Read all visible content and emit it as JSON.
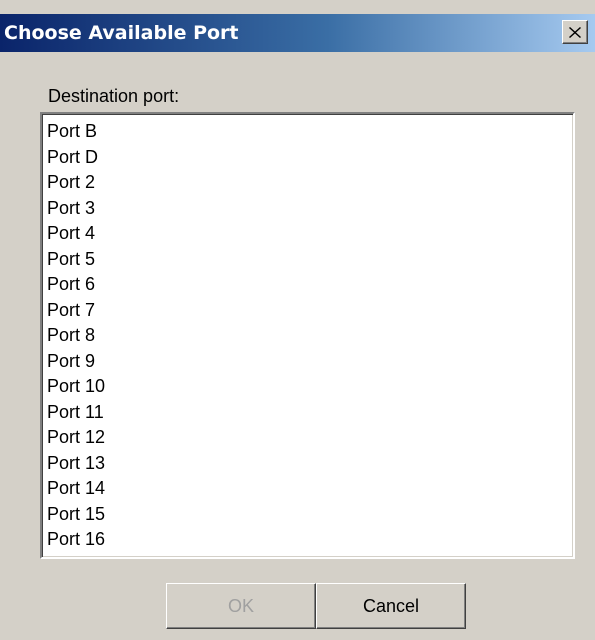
{
  "window": {
    "title": "Choose Available Port",
    "close_icon": "close-x-icon"
  },
  "form": {
    "destination_label": "Destination port:"
  },
  "port_list": {
    "items": [
      "Port B",
      "Port D",
      "Port 2",
      "Port 3",
      "Port 4",
      "Port 5",
      "Port 6",
      "Port 7",
      "Port 8",
      "Port 9",
      "Port 10",
      "Port 11",
      "Port 12",
      "Port 13",
      "Port 14",
      "Port 15",
      "Port 16"
    ]
  },
  "buttons": {
    "ok_label": "OK",
    "ok_enabled": false,
    "cancel_label": "Cancel"
  },
  "colors": {
    "title_gradient_start": "#0a246a",
    "title_gradient_end": "#a6caf0",
    "dialog_background": "#d4d0c8",
    "disabled_text": "#a0a0a0"
  }
}
